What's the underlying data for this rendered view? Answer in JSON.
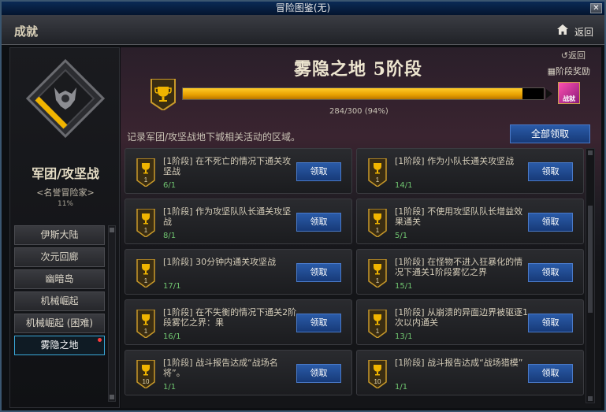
{
  "window": {
    "title": "冒险图鉴(无)"
  },
  "header": {
    "title": "成就",
    "back_label": "返回"
  },
  "sidebar": {
    "category_title": "军团/攻坚战",
    "category_subtitle": "<名誉冒险家>",
    "category_percent": "11%",
    "items": [
      {
        "label": "伊斯大陆"
      },
      {
        "label": "次元回廊"
      },
      {
        "label": "幽暗岛"
      },
      {
        "label": "机械崛起"
      },
      {
        "label": "机械崛起 (困难)"
      },
      {
        "label": "雾隐之地"
      }
    ]
  },
  "main": {
    "back_label": "返回",
    "stage_reward_label": "阶段奖励",
    "stage_title": "雾隐之地  5阶段",
    "progress_text": "284/300 (94%)",
    "progress_fraction": 0.94,
    "reward_icon_label": "战就",
    "description": "记录军团/攻坚战地下城相关活动的区域。",
    "claim_all_label": "全部领取",
    "claim_label": "领取",
    "cards": [
      {
        "badge": "1",
        "title": "[1阶段] 在不死亡的情况下通关攻坚战",
        "progress": "6/1"
      },
      {
        "badge": "1",
        "title": "[1阶段] 作为小队长通关攻坚战",
        "progress": "14/1"
      },
      {
        "badge": "1",
        "title": "[1阶段] 作为攻坚队队长通关攻坚战",
        "progress": "8/1"
      },
      {
        "badge": "1",
        "title": "[1阶段] 不使用攻坚队队长增益效果通关",
        "progress": "5/1"
      },
      {
        "badge": "1",
        "title": "[1阶段] 30分钟内通关攻坚战",
        "progress": "17/1"
      },
      {
        "badge": "1",
        "title": "[1阶段] 在怪物不进入狂暴化的情况下通关1阶段雾忆之界",
        "progress": "15/1"
      },
      {
        "badge": "1",
        "title": "[1阶段] 在不失衡的情况下通关2阶段雾忆之界：果",
        "progress": "16/1"
      },
      {
        "badge": "1",
        "title": "[1阶段] 从崩溃的异面边界被驱逐1次以内通关",
        "progress": "13/1"
      },
      {
        "badge": "10",
        "title": "[1阶段] 战斗报告达成“战场名将”。",
        "progress": "1/1"
      },
      {
        "badge": "10",
        "title": "[1阶段] 战斗报告达成“战场猎模”",
        "progress": "1/1"
      }
    ]
  },
  "colors": {
    "accent_gold": "#f0b400",
    "button_blue": "#2a5ba8",
    "progress_green": "#6fc46f"
  },
  "icons": [
    "close-icon",
    "home-icon",
    "back-icon",
    "stage-reward-icon",
    "trophy-icon"
  ]
}
